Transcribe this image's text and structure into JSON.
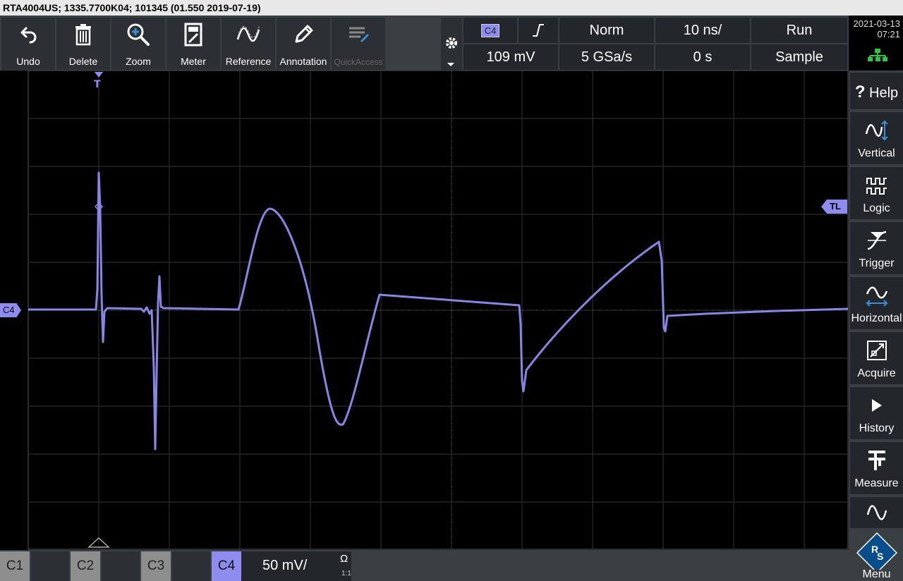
{
  "title": "RTA4004US; 1335.7700K04; 101345 (01.550 2019-07-19)",
  "toolbar": [
    {
      "label": "Undo",
      "icon": "undo-icon"
    },
    {
      "label": "Delete",
      "icon": "trash-icon"
    },
    {
      "label": "Zoom",
      "icon": "zoom-icon"
    },
    {
      "label": "Meter",
      "icon": "meter-icon"
    },
    {
      "label": "Reference",
      "icon": "reference-icon"
    },
    {
      "label": "Annotation",
      "icon": "pencil-icon"
    },
    {
      "label": "QuickAccess",
      "icon": "quickaccess-icon"
    }
  ],
  "trigger_info": {
    "source": "C4",
    "slope": "rising-edge",
    "mode": "Norm",
    "timebase": "10 ns/",
    "run": "Run",
    "level": "109 mV",
    "sample_rate": "5 GSa/s",
    "position": "0 s",
    "acq_mode": "Sample"
  },
  "clock": {
    "date": "2021-03-13",
    "time": "07:21"
  },
  "screen": {
    "channel_marker": "C4",
    "trigger_marker": "T",
    "trigger_level_marker": "TL",
    "trace_color": "#8f8cf0"
  },
  "sidebar": [
    {
      "label": "Help",
      "icon": "help-icon"
    },
    {
      "label": "Vertical",
      "icon": "vertical-icon"
    },
    {
      "label": "Logic",
      "icon": "logic-icon"
    },
    {
      "label": "Trigger",
      "icon": "trigger-icon"
    },
    {
      "label": "Horizontal",
      "icon": "horizontal-icon"
    },
    {
      "label": "Acquire",
      "icon": "acquire-icon"
    },
    {
      "label": "History",
      "icon": "history-icon"
    },
    {
      "label": "Measure",
      "icon": "measure-icon"
    },
    {
      "label": "",
      "icon": "math-icon"
    },
    {
      "label": "Menu",
      "icon": "rs-logo-icon"
    }
  ],
  "channels": [
    {
      "name": "C1",
      "value": ""
    },
    {
      "name": "C2",
      "value": ""
    },
    {
      "name": "C3",
      "value": ""
    },
    {
      "name": "C4",
      "value": "50 mV/",
      "coupling": "Ω",
      "probe": "1:1"
    }
  ]
}
